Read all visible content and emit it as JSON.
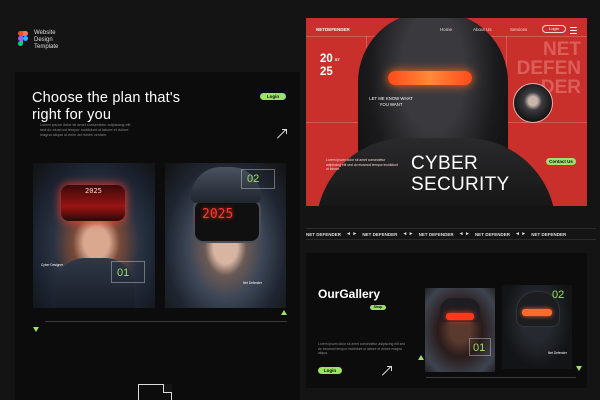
{
  "brand": {
    "lines": [
      "Website",
      "Design",
      "Template"
    ]
  },
  "left_panel": {
    "title": "Choose the plan that's right for you",
    "login_label": "Login",
    "description": "Lorem ipsum dolor sit amet consectetur adipiscing elit sed do eiusmod tempor incididunt ut labore et dolore magna aliqua ut enim ad minim veniam.",
    "card1": {
      "visor_text": "2025",
      "number": "01",
      "caption": "Cyber Designer"
    },
    "card2": {
      "visor_text": "2025",
      "number": "02",
      "caption": "Net Defender"
    }
  },
  "hero": {
    "logo": "NETDEFENDER",
    "nav": [
      "Home",
      "About Us",
      "Services"
    ],
    "login_label": "Login",
    "year_top": "20",
    "year_sup": "ST",
    "year_bottom": "25",
    "ghost_lines": [
      "NET",
      "DEFEN",
      "DER"
    ],
    "let_me_know": "LET ME KNOW WHAT YOU WANT",
    "title_line1": "CYBER",
    "title_line2": "SECURITY",
    "description": "Lorem ipsum dolor sit amet consectetur adipiscing elit sed do eiusmod tempor incididunt ut labore.",
    "contact_label": "Contact Us"
  },
  "ticker": {
    "items": [
      "NET DEFENDER",
      "NET DEFENDER",
      "NET DEFENDER",
      "NET DEFENDER",
      "NET DEFENDER"
    ],
    "separator": "◄ ►"
  },
  "gallery": {
    "title": "OurGallery",
    "shop_label": "Shop",
    "description": "Lorem ipsum dolor sit amet consectetur adipiscing elit sed do eiusmod tempor incididunt ut labore et dolore magna aliqua.",
    "login_label": "Login",
    "card1": {
      "number": "01"
    },
    "card2": {
      "number": "02",
      "caption": "Net Defender"
    }
  },
  "colors": {
    "accent": "#9be265",
    "hero_red": "#c9302c",
    "panel": "#0c0c0c",
    "background": "#141414"
  }
}
